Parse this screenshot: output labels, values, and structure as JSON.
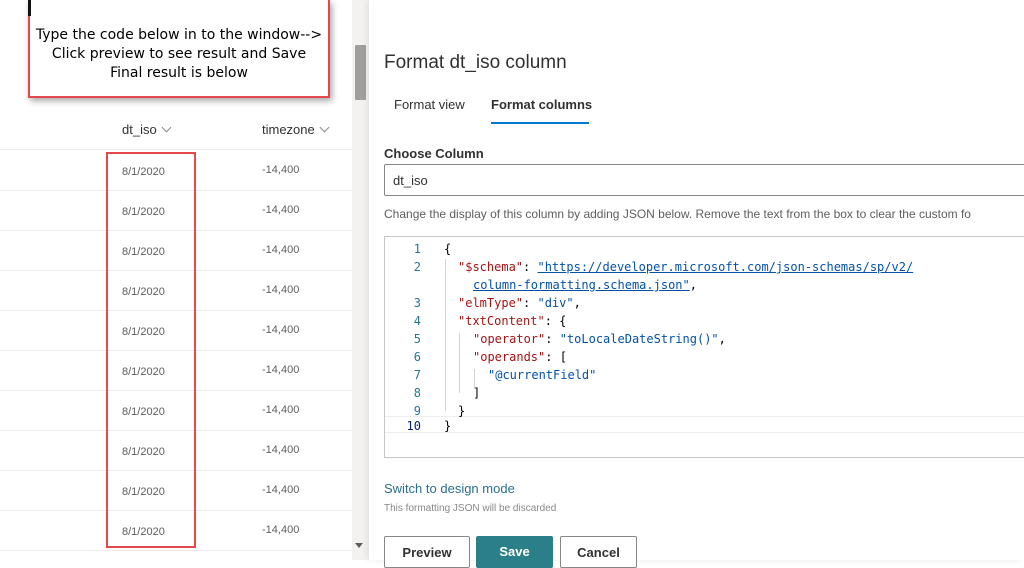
{
  "callout": {
    "lines": [
      "Type the code below in to the window-->",
      "Click preview to see result and Save",
      "Final result is below"
    ]
  },
  "list": {
    "columns": [
      {
        "label": "dt_iso"
      },
      {
        "label": "timezone"
      }
    ],
    "rows": [
      {
        "dt_iso": "8/1/2020",
        "timezone": "-14,400"
      },
      {
        "dt_iso": "8/1/2020",
        "timezone": "-14,400"
      },
      {
        "dt_iso": "8/1/2020",
        "timezone": "-14,400"
      },
      {
        "dt_iso": "8/1/2020",
        "timezone": "-14,400"
      },
      {
        "dt_iso": "8/1/2020",
        "timezone": "-14,400"
      },
      {
        "dt_iso": "8/1/2020",
        "timezone": "-14,400"
      },
      {
        "dt_iso": "8/1/2020",
        "timezone": "-14,400"
      },
      {
        "dt_iso": "8/1/2020",
        "timezone": "-14,400"
      },
      {
        "dt_iso": "8/1/2020",
        "timezone": "-14,400"
      },
      {
        "dt_iso": "8/1/2020",
        "timezone": "-14,400"
      }
    ]
  },
  "panel": {
    "title": "Format dt_iso column",
    "tabs": [
      {
        "label": "Format view"
      },
      {
        "label": "Format columns"
      }
    ],
    "choose_label": "Choose Column",
    "choose_value": "dt_iso",
    "description": "Change the display of this column by adding JSON below. Remove the text from the box to clear the custom fo",
    "editor": {
      "line_numbers": [
        "1",
        "2",
        "3",
        "4",
        "5",
        "6",
        "7",
        "8",
        "9",
        "10"
      ],
      "l1": "{",
      "l2_key": "\"$schema\"",
      "l2_colon": ": ",
      "l2_url_a": "\"https://developer.microsoft.com/json-schemas/sp/v2/",
      "l2_url_b": "column-formatting.schema.json\"",
      "l2_end": ",",
      "l3_key": "\"elmType\"",
      "l3_colon": ": ",
      "l3_val": "\"div\"",
      "l3_end": ",",
      "l4_key": "\"txtContent\"",
      "l4_rest": ": {",
      "l5_key": "\"operator\"",
      "l5_colon": ": ",
      "l5_val": "\"toLocaleDateString()\"",
      "l5_end": ",",
      "l6_key": "\"operands\"",
      "l6_rest": ": [",
      "l7_val": "\"@currentField\"",
      "l8": "]",
      "l9": "}",
      "l10": "}"
    },
    "switch_link": "Switch to design mode",
    "discard_note": "This formatting JSON will be discarded",
    "buttons": {
      "preview": "Preview",
      "save": "Save",
      "cancel": "Cancel"
    }
  },
  "colors": {
    "accent": "#0078d4",
    "save_button": "#2b7f88",
    "highlight_border": "#e5474a"
  }
}
